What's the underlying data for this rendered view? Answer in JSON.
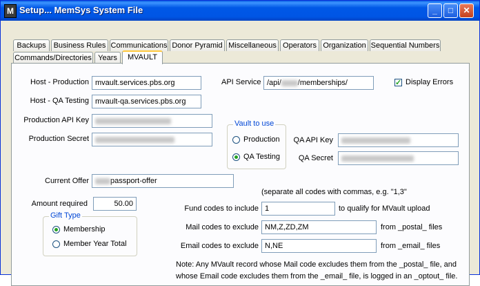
{
  "window": {
    "title": "Setup... MemSys System File",
    "app_icon": "M"
  },
  "tabs_row1": [
    "Backups",
    "Business Rules",
    "Communications",
    "Donor Pyramid",
    "Miscellaneous",
    "Operators",
    "Organization",
    "Sequential Numbers"
  ],
  "tabs_row2": [
    "Commands/Directories",
    "Years",
    "MVAULT"
  ],
  "active_tab": "MVAULT",
  "form": {
    "host_production_label": "Host - Production",
    "host_production_value": "mvault.services.pbs.org",
    "host_qa_label": "Host - QA Testing",
    "host_qa_value": "mvault-qa.services.pbs.org",
    "prod_api_key_label": "Production API Key",
    "prod_secret_label": "Production Secret",
    "api_service_label": "API Service",
    "api_service_prefix": "/api/",
    "api_service_suffix": "/memberships/",
    "display_errors_label": "Display Errors",
    "display_errors_checked": true,
    "vault_group_title": "Vault to use",
    "vault_production_label": "Production",
    "vault_qa_label": "QA Testing",
    "vault_selected": "QA Testing",
    "qa_api_key_label": "QA API Key",
    "qa_secret_label": "QA Secret",
    "current_offer_label": "Current Offer",
    "current_offer_suffix": "passport-offer",
    "separate_note": "(separate all codes with commas, e.g. \"1,3\"",
    "amount_required_label": "Amount required",
    "amount_required_value": "50.00",
    "gift_type_title": "Gift Type",
    "gift_membership_label": "Membership",
    "gift_member_year_label": "Member Year Total",
    "gift_selected": "Membership",
    "fund_codes_label": "Fund codes to include",
    "fund_codes_value": "1",
    "fund_codes_suffix": "to qualify for MVault upload",
    "mail_codes_label": "Mail codes to exclude",
    "mail_codes_value": "NM,Z,ZD,ZM",
    "mail_codes_suffix": "from _postal_ files",
    "email_codes_label": "Email codes to exclude",
    "email_codes_value": "N,NE",
    "email_codes_suffix": "from _email_ files",
    "note_line1": "Note: Any MVault record whose Mail code excludes them from the _postal_ file, and",
    "note_line2": "whose Email code excludes them from the _email_ file, is logged in an _optout_ file."
  }
}
